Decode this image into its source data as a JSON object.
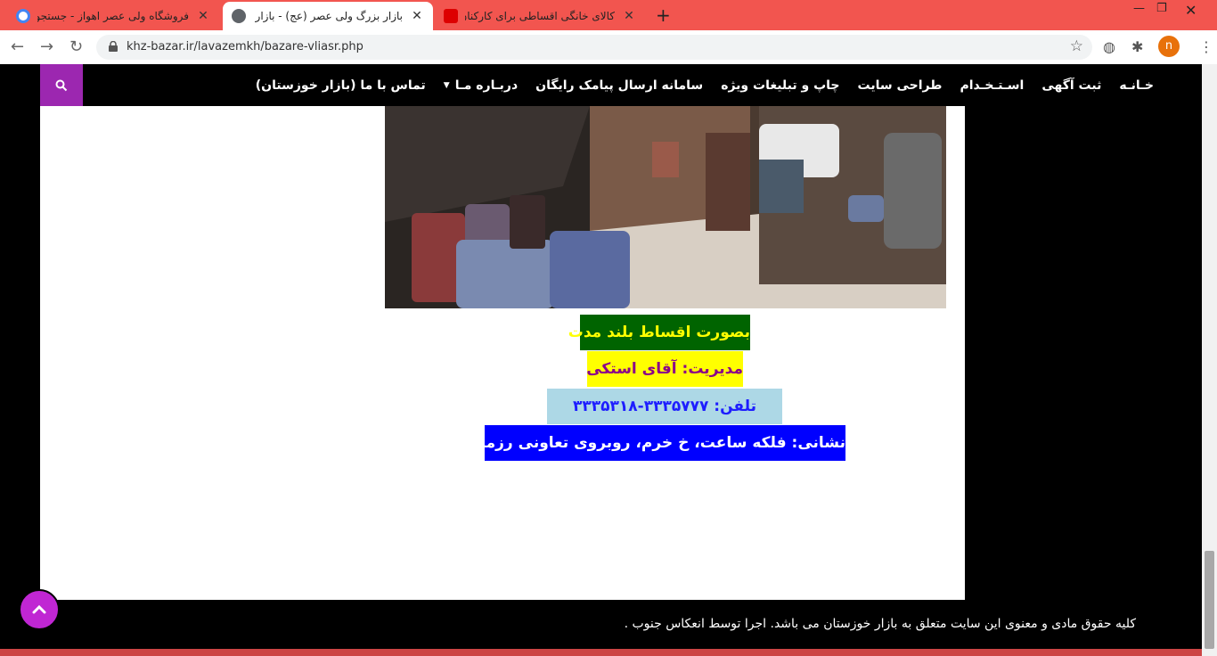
{
  "browser": {
    "tabs": [
      {
        "title": "فروشگاه ولی عصر اهواز - جستجوی",
        "active": false
      },
      {
        "title": "بازار بزرگ ولی عصر (عج) - بازار ولی",
        "active": true
      },
      {
        "title": "کالای خانگی اقساطی برای کارکنان و",
        "active": false
      }
    ],
    "url": "khz-bazar.ir/lavazemkh/bazare-vliasr.php",
    "profile_initial": "n"
  },
  "navbar": {
    "items": [
      "خـانـه",
      "ثبت آگهی",
      "اسـتـخـدام",
      "طراحی سایت",
      "چاپ و تبلیغات ویژه",
      "سامانه ارسال پیامک رایگان",
      "دربـاره مـا",
      "تماس با ما (بازار خوزستان)"
    ]
  },
  "info": {
    "installments": "بصورت اقساط بلند مدت",
    "manager": "مدیریت: آقای استکی",
    "phone": "تلفن: ۳۳۳۵۷۷۷-۳۳۳۵۳۱۸",
    "address": "نشانی: فلکه ساعت، خ خرم، روبروی تعاونی رزمندگان"
  },
  "footer": {
    "copyright": "کلیه حقوق مادی و معنوی این سایت متعلق به بازار خوزستان می باشد. اجرا توسط انعکاس جنوب ."
  },
  "colors": {
    "tabstrip": "#f2554f",
    "accent": "#9c27b0"
  }
}
